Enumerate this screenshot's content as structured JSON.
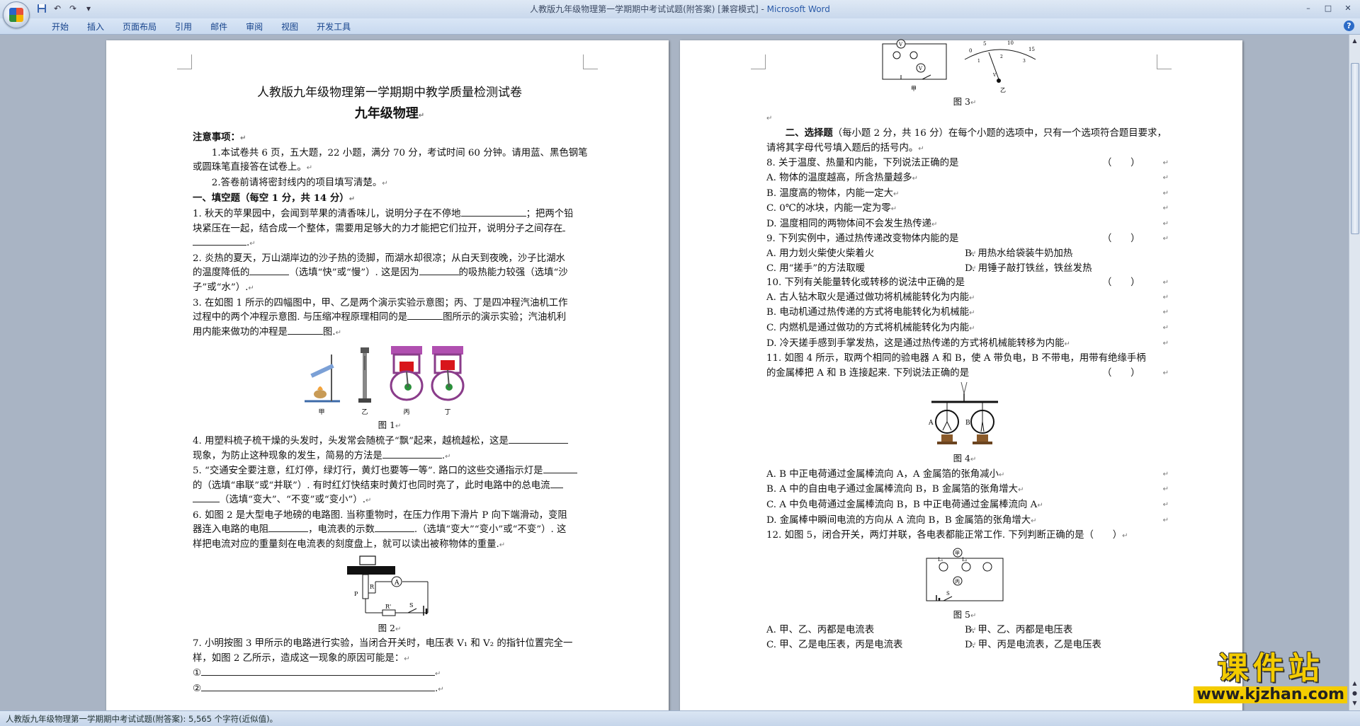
{
  "window": {
    "title": "人教版九年级物理第一学期期中考试试题(附答案) [兼容模式] - ",
    "app_name": "Microsoft Word",
    "controls": [
      "–",
      "□",
      "✕"
    ]
  },
  "qat": {
    "items": [
      "save-icon",
      "undo-icon",
      "redo-icon",
      "customize-icon"
    ]
  },
  "ribbon": {
    "tabs": [
      "开始",
      "插入",
      "页面布局",
      "引用",
      "邮件",
      "审阅",
      "视图",
      "开发工具"
    ],
    "help": "?"
  },
  "left_page": {
    "title": "人教版九年级物理第一学期期中教学质量检测试卷",
    "subtitle": "九年级物理",
    "notice_head": "注意事项：",
    "notice_1a": "1.本试卷共 6 页，五大题，22 小题，满分 70 分，考试时间 60 分钟。请用蓝、黑色钢笔",
    "notice_1b": "或圆珠笔直接答在试卷上。",
    "notice_2": "2.答卷前请将密封线内的项目填写清楚。",
    "section1": "一、填空题（每空 1 分，共 14 分）",
    "q1a": "1. 秋天的苹果园中，会闻到苹果的清香味儿，说明分子在不停地",
    "q1b": "；把两个铅",
    "q1c": "块紧压在一起，结合成一个整体，需要用足够大的力才能把它们拉开，说明分子之间存在",
    "q2a": "2. 炎热的夏天，万山湖岸边的沙子热的烫脚，而湖水却很凉；从白天到夜晚，沙子比湖水",
    "q2b": "的温度降低的",
    "q2c": "（选填“快”或“慢”）. 这是因为",
    "q2d": "的吸热能力较强（选填“沙",
    "q2e": "子”或“水”）.",
    "q3a": "3. 在如图 1 所示的四幅图中，甲、乙是两个演示实验示意图；丙、丁是四冲程汽油机工作",
    "q3b": "过程中的两个冲程示意图. 与压缩冲程原理相同的是",
    "q3c": "图所示的演示实验；汽油机利",
    "q3d": "用内能来做功的冲程是",
    "q3e": "图.",
    "fig1_labels": [
      "甲",
      "乙",
      "丙",
      "丁"
    ],
    "fig1_caption": "图 1",
    "q4a": "4. 用塑料梳子梳干燥的头发时，头发常会随梳子“飘”起来，越梳越松，这是",
    "q4b": "现象，为防止这种现象的发生，简易的方法是",
    "q5a": "5. “交通安全要注意，红灯停，绿灯行，黄灯也要等一等”. 路口的这些交通指示灯是",
    "q5b": "的（选填“串联”或“并联”）. 有时红灯快结束时黄灯也同时亮了，此时电路中的总电流",
    "q5c": "（选填“变大”、“不变”或“变小”）.",
    "q6a": "6. 如图 2 是大型电子地磅的电路图. 当称重物时，在压力作用下滑片 P 向下端滑动，变阻",
    "q6b": "器连入电路的电阻",
    "q6c": "，电流表的示数",
    "q6d": ".（选填“变大”“变小”或“不变”）. 这",
    "q6e": "样把电流对应的重量刻在电流表的刻度盘上，就可以读出被称物体的重量.",
    "fig2_labels": [
      "A",
      "P",
      "R",
      "R'",
      "S"
    ],
    "fig2_caption": "图 2",
    "q7a": "7. 小明按图 3 甲所示的电路进行实验，当闭合开关时，电压表 V₁ 和 V₂ 的指针位置完全一",
    "q7b": "样，如图 2 乙所示，造成这一现象的原因可能是：",
    "q7_opt1": "①",
    "q7_opt2": "②"
  },
  "right_page": {
    "fig3_labels": [
      "V",
      "V",
      "甲",
      "乙",
      "0",
      "5",
      "10",
      "15",
      "1",
      "2",
      "3",
      "V"
    ],
    "fig3_caption": "图 3",
    "section2_head": "二、选择题",
    "section2_rest": "（每小题 2 分，共 16 分）在每个小题的选项中，只有一个选项符合题目要求，",
    "section2_line2": "请将其字母代号填入题后的括号内。",
    "q8": "8. 关于温度、热量和内能，下列说法正确的是",
    "q8_paren": "（　　）",
    "q8_opts": [
      "A. 物体的温度越高，所含热量越多",
      "B. 温度高的物体，内能一定大",
      "C. 0℃的冰块，内能一定为零",
      "D. 温度相同的两物体间不会发生热传递"
    ],
    "q9": "9. 下列实例中，通过热传递改变物体内能的是",
    "q9_paren": "（　　）",
    "q9_opts": [
      "A. 用力划火柴使火柴着火",
      "B. 用热水给袋装牛奶加热",
      "C. 用“搓手”的方法取暖",
      "D. 用锤子敲打铁丝，铁丝发热"
    ],
    "q10": "10. 下列有关能量转化或转移的说法中正确的是",
    "q10_paren": "（　　）",
    "q10_opts": [
      "A. 古人钻木取火是通过做功将机械能转化为内能",
      "B. 电动机通过热传递的方式将电能转化为机械能",
      "C. 内燃机是通过做功的方式将机械能转化为内能",
      "D. 冷天搓手感到手掌发热，这是通过热传递的方式将机械能转移为内能"
    ],
    "q11a": "11. 如图 4 所示，取两个相同的验电器 A 和 B，使 A 带负电，B 不带电，用带有绝缘手柄",
    "q11b": "的金属棒把 A 和 B 连接起来. 下列说法正确的是",
    "q11_paren": "（　　）",
    "fig4_labels": [
      "A",
      "B"
    ],
    "fig4_caption": "图 4",
    "q11_opts": [
      "A. B 中正电荷通过金属棒流向 A，A 金属箔的张角减小",
      "B. A 中的自由电子通过金属棒流向 B，B 金属箔的张角增大",
      "C. A 中负电荷通过金属棒流向 B，B 中正电荷通过金属棒流向 A",
      "D. 金属棒中瞬间电流的方向从 A 流向 B，B 金属箔的张角增大"
    ],
    "q12": "12. 如图 5，闭合开关，两灯并联，各电表都能正常工作. 下列判断正确的是（　　）",
    "fig5_labels": [
      "甲",
      "L₁",
      "L₂",
      "丙",
      "S"
    ],
    "fig5_caption": "图 5",
    "q12_opts": [
      "A. 甲、乙、丙都是电流表",
      "B. 甲、乙、丙都是电压表",
      "C. 甲、乙是电压表，丙是电流表",
      "D. 甲、丙是电流表，乙是电压表"
    ]
  },
  "status_bar": {
    "text": "人教版九年级物理第一学期期中考试试题(附答案): 5,565 个字符(近似值)。"
  },
  "watermark": {
    "top": "课件站",
    "bottom": "www.kjzhan.com"
  },
  "colors": {
    "title_bar": "#dfe9f5",
    "ribbon_text": "#15428b",
    "workspace": "#a9b4c4",
    "watermark": "#f4cc00"
  }
}
